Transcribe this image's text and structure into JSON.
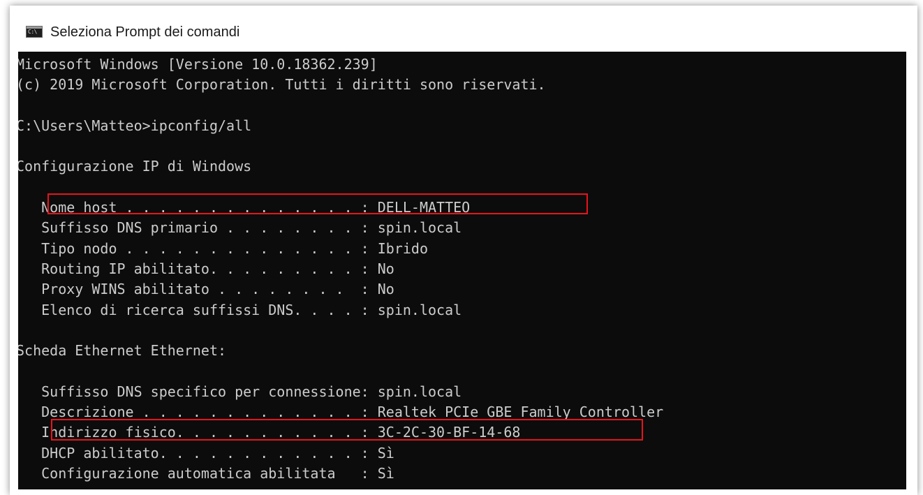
{
  "window": {
    "title": "Seleziona Prompt dei comandi",
    "icon": "cmd-icon",
    "icon_glyph": "C:\\"
  },
  "console": {
    "background_color": "#0c0c0c",
    "text_color": "#cccccc",
    "highlight_color": "#e8141c",
    "lines": [
      "Microsoft Windows [Versione 10.0.18362.239]",
      "(c) 2019 Microsoft Corporation. Tutti i diritti sono riservati.",
      "",
      "C:\\Users\\Matteo>ipconfig/all",
      "",
      "Configurazione IP di Windows",
      "",
      "   Nome host . . . . . . . . . . . . . . : DELL-MATTEO",
      "   Suffisso DNS primario . . . . . . . . : spin.local",
      "   Tipo nodo . . . . . . . . . . . . . . : Ibrido",
      "   Routing IP abilitato. . . . . . . . . : No",
      "   Proxy WINS abilitato . . . . . . . .  : No",
      "   Elenco di ricerca suffissi DNS. . . . : spin.local",
      "",
      "Scheda Ethernet Ethernet:",
      "",
      "   Suffisso DNS specifico per connessione: spin.local",
      "   Descrizione . . . . . . . . . . . . . : Realtek PCIe GBE Family Controller",
      "   Indirizzo fisico. . . . . . . . . . . : 3C-2C-30-BF-14-68",
      "   DHCP abilitato. . . . . . . . . . . . : Sì",
      "   Configurazione automatica abilitata   : Sì"
    ]
  }
}
